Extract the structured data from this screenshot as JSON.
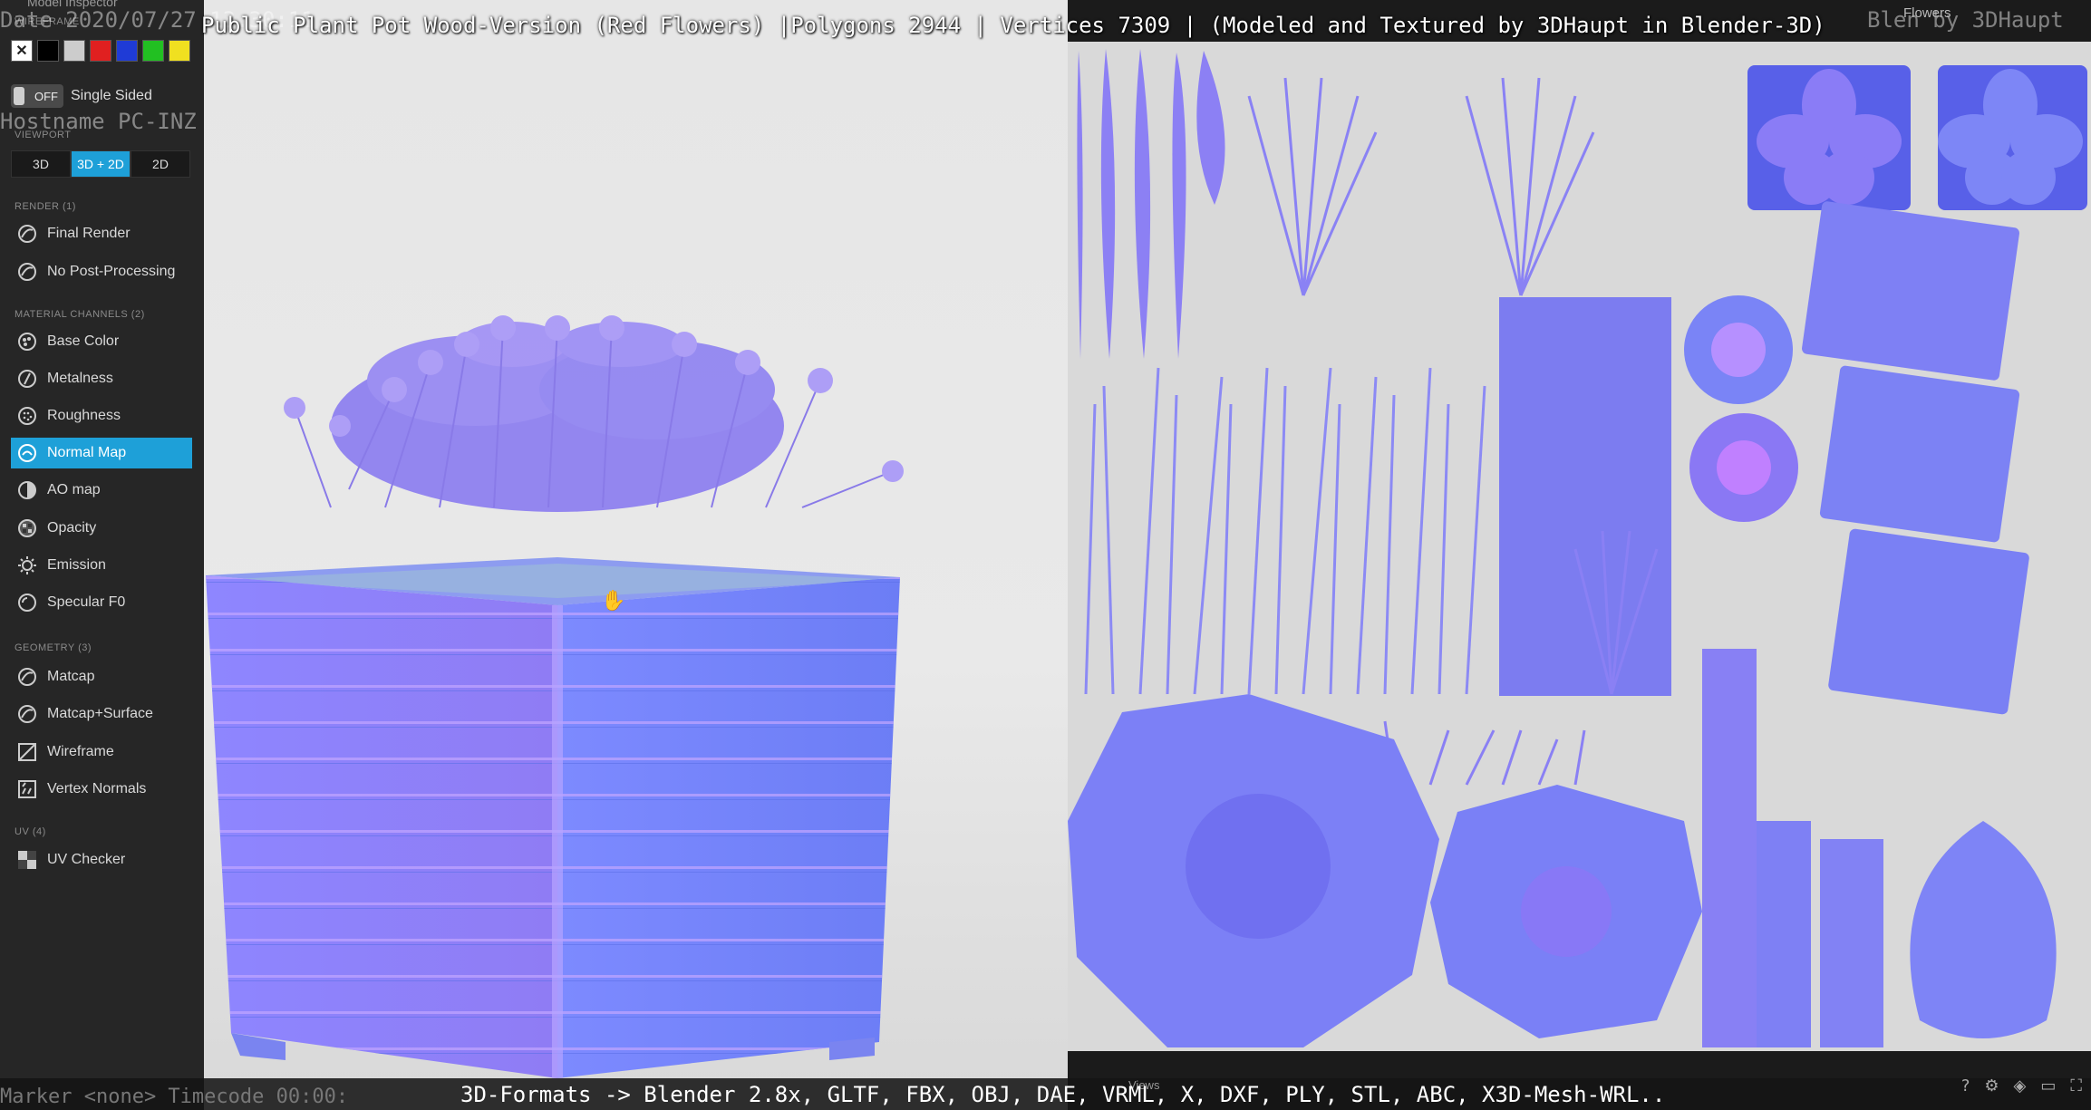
{
  "title": "Public Plant Pot Wood-Version (Red Flowers) |Polygons 2944 | Vertices 7309 | (Modeled and Textured by 3DHaupt in Blender-3D)",
  "footer": "3D-Formats -> Blender 2.8x, GLTF, FBX, OBJ, DAE, VRML, X, DXF, PLY, STL, ABC, X3D-Mesh-WRL..",
  "overlay": {
    "date": "Date 2020/07/27 13:30:11",
    "hostname": "Hostname PC-INZ",
    "marker": "Marker <none>  Timecode 00:00:",
    "top_right": "Blen by 3DHaupt"
  },
  "tab_label": "Flowers",
  "views_label": "Views",
  "sidebar": {
    "header": "Model Inspector",
    "wireframe_label": "WIREFRAME",
    "swatch_colors": [
      "#ffffff",
      "#000000",
      "#cccccc",
      "#e02020",
      "#1f3bd6",
      "#22c022",
      "#f0e020"
    ],
    "single_sided_toggle": "OFF",
    "single_sided_label": "Single Sided",
    "viewport_label": "VIEWPORT",
    "viewport_buttons": [
      "3D",
      "3D + 2D",
      "2D"
    ],
    "viewport_active": "3D + 2D",
    "render_label": "RENDER (1)",
    "render_items": [
      "Final Render",
      "No Post-Processing"
    ],
    "material_label": "MATERIAL CHANNELS (2)",
    "material_items": [
      "Base Color",
      "Metalness",
      "Roughness",
      "Normal Map",
      "AO map",
      "Opacity",
      "Emission",
      "Specular F0"
    ],
    "material_active": "Normal Map",
    "geometry_label": "GEOMETRY (3)",
    "geometry_items": [
      "Matcap",
      "Matcap+Surface",
      "Wireframe",
      "Vertex Normals"
    ],
    "uv_label": "UV (4)",
    "uv_items": [
      "UV Checker"
    ]
  },
  "colors": {
    "accent": "#1ea0d8",
    "normal_map_base": "#7f7fff",
    "normal_map_light": "#9a8cff",
    "normal_map_pink": "#c880ff",
    "normal_map_cyan": "#6ab8ff"
  }
}
